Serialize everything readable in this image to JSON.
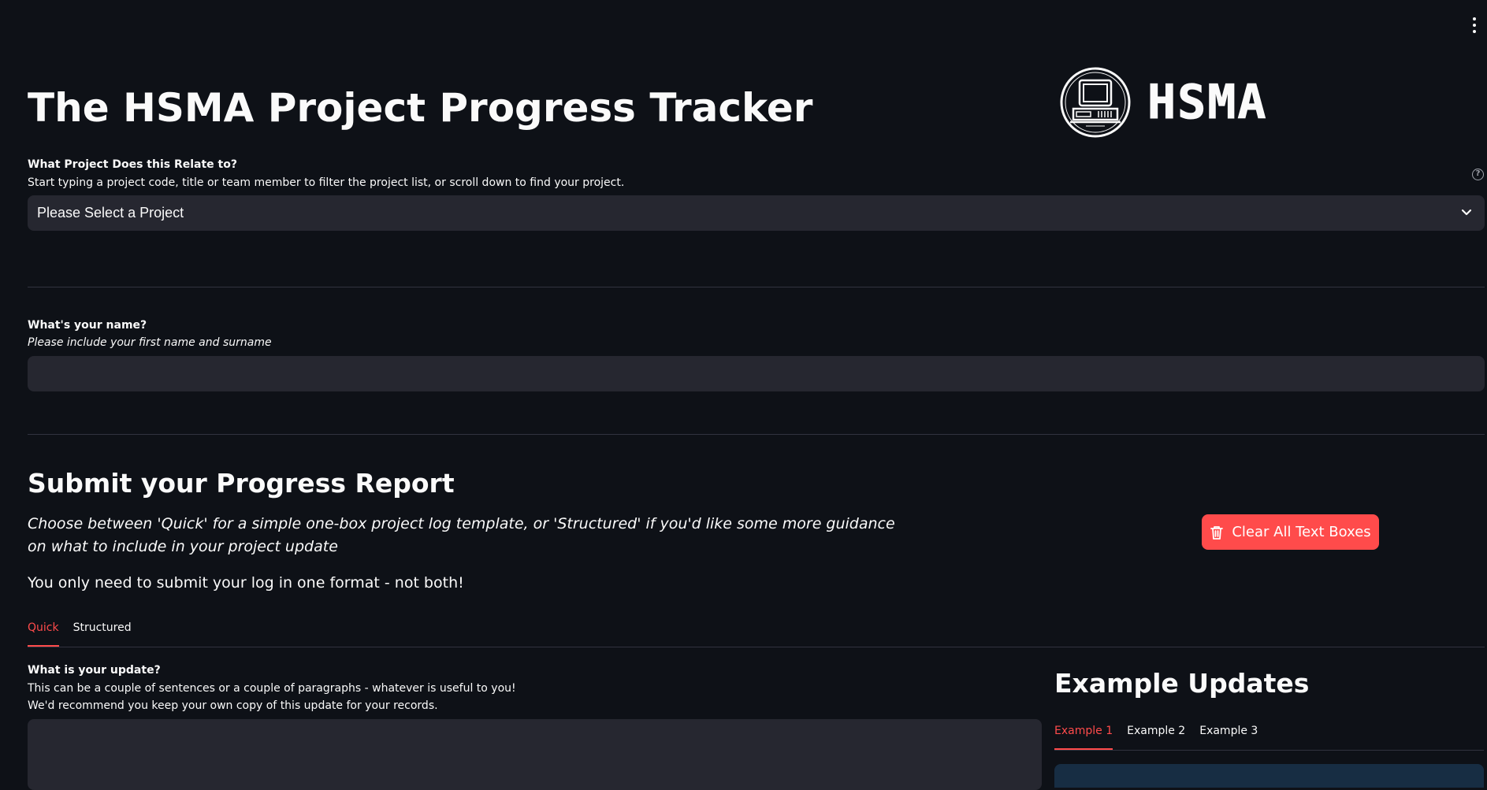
{
  "app": {
    "title": "The HSMA Project Progress Tracker",
    "logo_text": "HSMA"
  },
  "project_select": {
    "label": "What Project Does this Relate to?",
    "help": "Start typing a project code, title or team member to filter the project list, or scroll down to find your project.",
    "value": "Please Select a Project"
  },
  "name_field": {
    "label": "What's your name?",
    "help": "Please include your first name and surname",
    "value": ""
  },
  "progress": {
    "title": "Submit your Progress Report",
    "intro": "Choose between 'Quick' for a simple one-box project log template, or 'Structured' if you'd like some more guidance on what to include in your project update",
    "note": "You only need to submit your log in one format - not both!",
    "clear_label": "Clear All Text Boxes",
    "tabs": [
      {
        "label": "Quick",
        "active": true
      },
      {
        "label": "Structured",
        "active": false
      }
    ]
  },
  "update_field": {
    "label": "What is your update?",
    "help_line1": "This can be a couple of sentences or a couple of paragraphs - whatever is useful to you!",
    "help_line2": "We'd recommend you keep your own copy of this update for your records.",
    "value": ""
  },
  "examples": {
    "title": "Example Updates",
    "tabs": [
      {
        "label": "Example 1",
        "active": true
      },
      {
        "label": "Example 2",
        "active": false
      },
      {
        "label": "Example 3",
        "active": false
      }
    ]
  },
  "colors": {
    "background": "#0e1117",
    "accent": "#ff4b4b",
    "input_bg": "#262730",
    "info_bg": "#172d43"
  },
  "icons": [
    "kebab-menu-icon",
    "help-icon",
    "chevron-down-icon",
    "trash-icon",
    "computer-logo-icon"
  ]
}
